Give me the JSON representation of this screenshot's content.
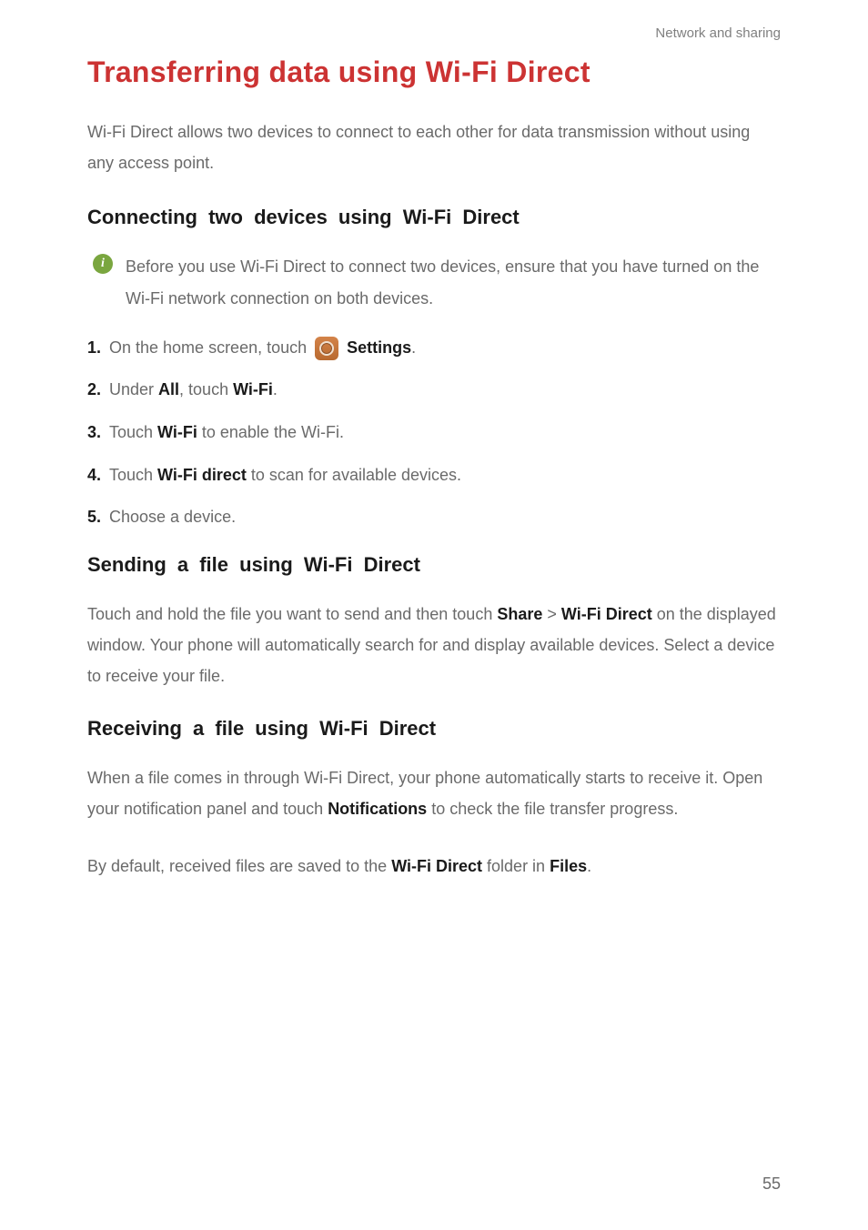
{
  "header": "Network and sharing",
  "title": "Transferring data using Wi-Fi Direct",
  "intro": "Wi-Fi Direct allows two devices to connect to each other for data transmission without using any access point.",
  "section1": {
    "title": "Connecting two devices using Wi-Fi Direct",
    "info": "Before you use Wi-Fi Direct to connect two devices, ensure that you have turned on the Wi-Fi network connection on both devices.",
    "steps": {
      "s1_prefix": "On the home screen, touch ",
      "s1_suffix": "Settings",
      "s1_end": ".",
      "s2_prefix": "Under ",
      "s2_all": "All",
      "s2_mid": ", touch ",
      "s2_wifi": "Wi-Fi",
      "s2_end": ".",
      "s3_prefix": "Touch ",
      "s3_wifi": "Wi-Fi",
      "s3_suffix": " to enable the Wi-Fi.",
      "s4_prefix": "Touch ",
      "s4_wfd": "Wi-Fi direct",
      "s4_suffix": " to scan for available devices.",
      "s5": "Choose a device."
    }
  },
  "section2": {
    "title": "Sending a file using Wi-Fi Direct",
    "p1_a": "Touch and hold the file you want to send and then touch ",
    "p1_share": "Share",
    "p1_gt": " > ",
    "p1_wfd": "Wi-Fi Direct",
    "p1_b": " on the displayed window. Your phone will automatically search for and display available devices. Select a device to receive your file."
  },
  "section3": {
    "title": "Receiving a file using Wi-Fi Direct",
    "p1_a": "When a file comes in through Wi-Fi Direct, your phone automatically starts to receive it. Open your notification panel and touch ",
    "p1_notif": "Notifications",
    "p1_b": " to check the file transfer progress.",
    "p2_a": "By default, received files are saved to the ",
    "p2_wfd": "Wi-Fi Direct",
    "p2_mid": " folder in ",
    "p2_files": "Files",
    "p2_end": "."
  },
  "pageNumber": "55"
}
